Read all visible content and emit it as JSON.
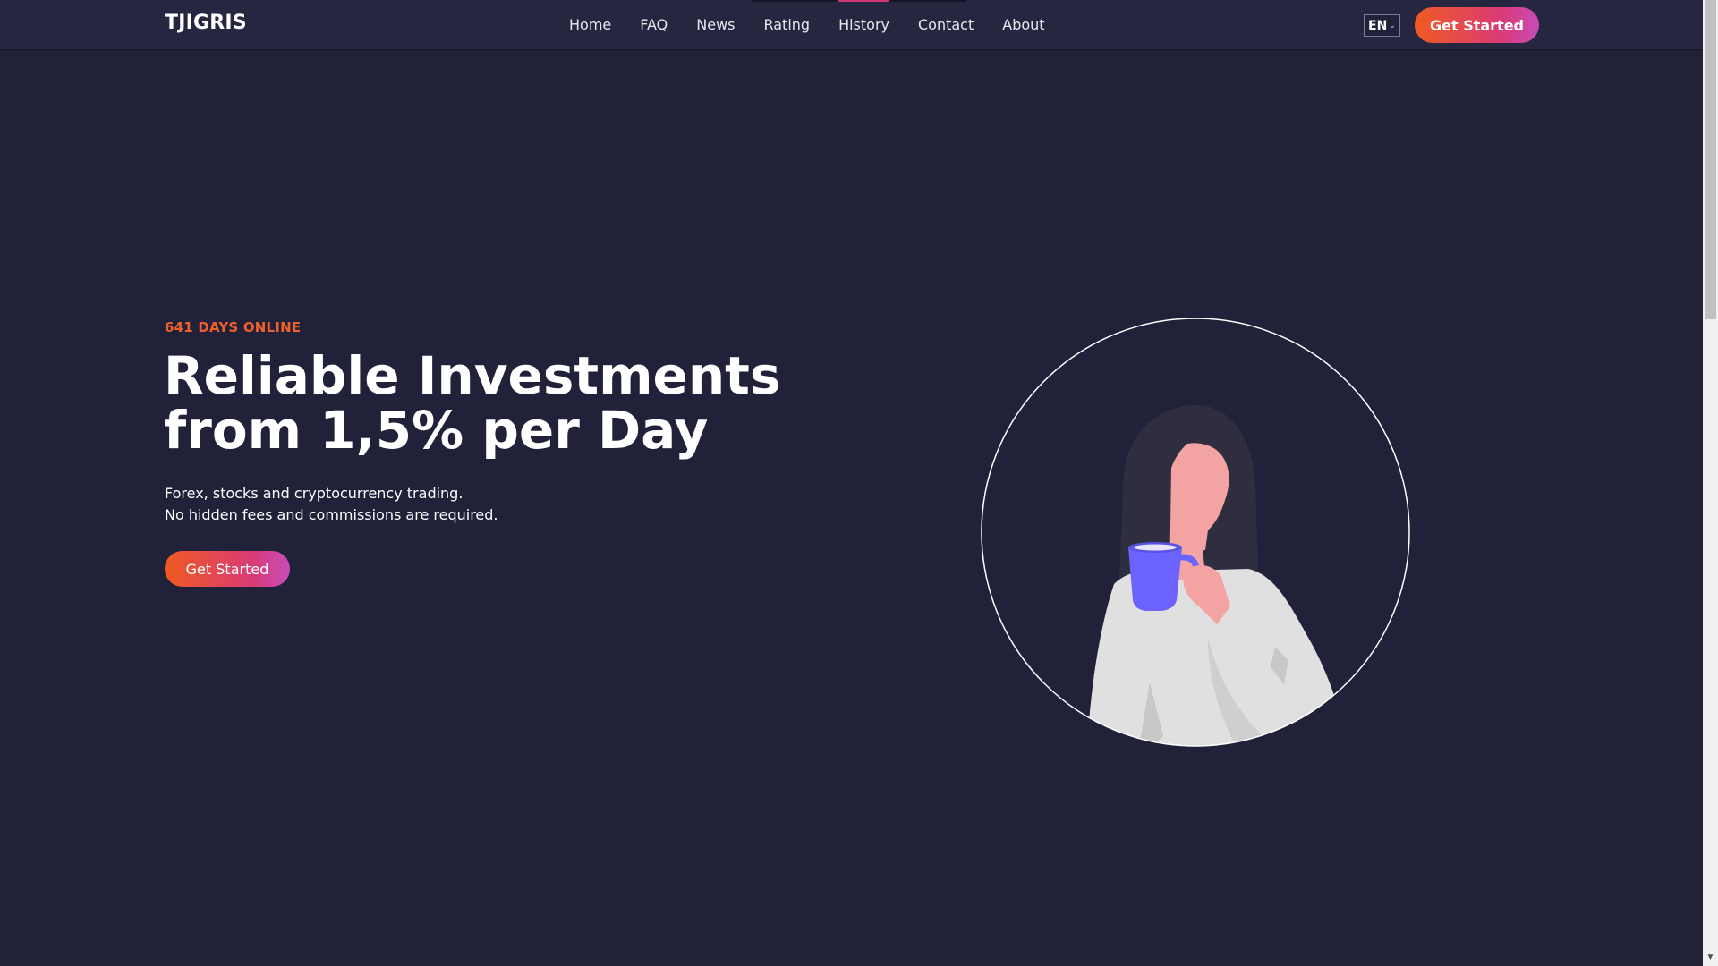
{
  "header": {
    "logo": "TJIGRIS",
    "nav": [
      {
        "label": "Home"
      },
      {
        "label": "FAQ"
      },
      {
        "label": "News"
      },
      {
        "label": "Rating"
      },
      {
        "label": "History"
      },
      {
        "label": "Contact"
      },
      {
        "label": "About"
      }
    ],
    "language": "EN",
    "cta_label": "Get Started"
  },
  "hero": {
    "tagline": "641 DAYS ONLINE",
    "title_line1": "Reliable Investments",
    "title_line2": "from 1,5% per Day",
    "desc_line1": "Forex, stocks and cryptocurrency trading.",
    "desc_line2": "No hidden fees and commissions are required.",
    "cta_label": "Get Started"
  },
  "colors": {
    "background": "#21213a",
    "header": "#262640",
    "accent_orange": "#f05a22",
    "accent_pink": "#d93b76",
    "accent_purple": "#c84bb9",
    "mug": "#6c63ff",
    "skin": "#f4a3a3",
    "sweater": "#e0e0e0",
    "hair": "#2f2e41"
  },
  "icons": {
    "lang_dropdown": "chevron-down-icon",
    "illustration": "woman-drinking-coffee-illustration"
  }
}
